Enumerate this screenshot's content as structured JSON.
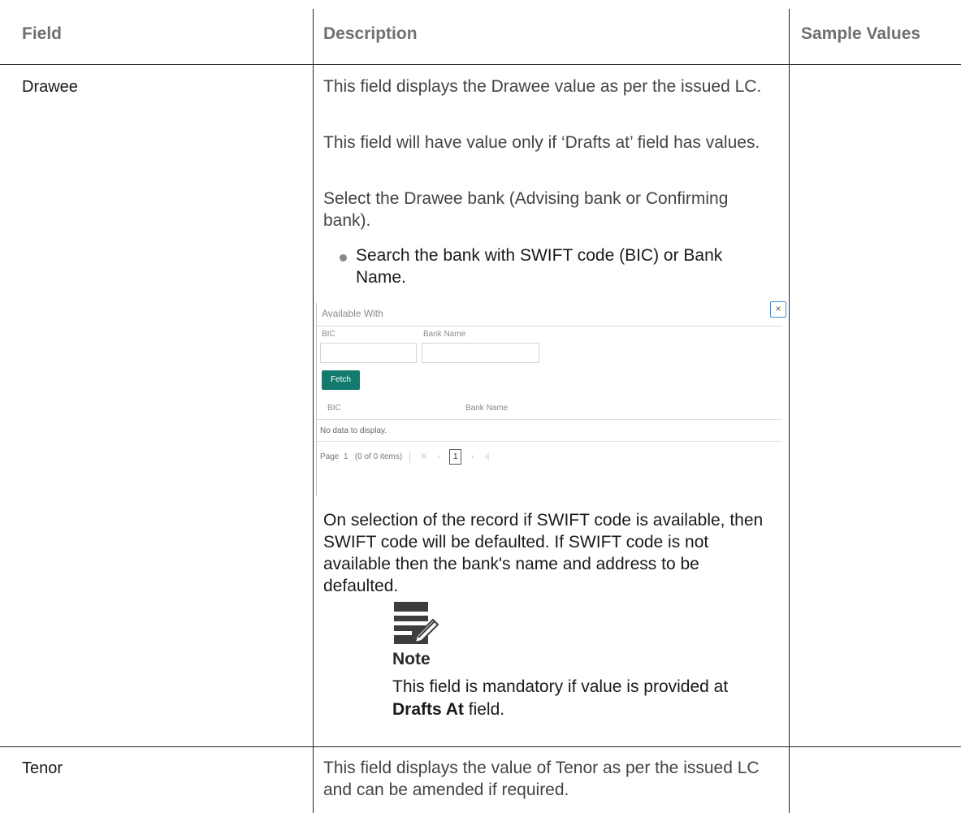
{
  "headers": {
    "field": "Field",
    "description": "Description",
    "sample_values": "Sample Values"
  },
  "rows": [
    {
      "field": "Drawee",
      "paragraphs": [
        "This field displays the Drawee value as per the issued LC.",
        "This field will have value only if ‘Drafts at’ field has values.",
        "Select the Drawee bank (Advising bank or Confirming bank)."
      ],
      "bullet": "Search the bank with SWIFT code (BIC) or Bank Name.",
      "after_image": "On selection of the record if SWIFT code is available, then SWIFT code will be defaulted. If SWIFT code is not available then the bank's name and address to be defaulted.",
      "note": {
        "label": "Note",
        "text_before": "This field is mandatory if value is provided at ",
        "bold": "Drafts At",
        "text_after": " field."
      }
    },
    {
      "field": "Tenor",
      "paragraphs": [
        "This field displays the value of Tenor as per the issued LC and can be amended if required."
      ]
    }
  ],
  "dialog": {
    "title": "Available With",
    "close_icon": "close-icon",
    "bic_label": "BIC",
    "bank_name_label": "Bank Name",
    "bic_value": "",
    "bank_name_value": "",
    "fetch_label": "Fetch",
    "columns": [
      "BIC",
      "Bank Name"
    ],
    "empty_message": "No data to display.",
    "pager": {
      "page_label": "Page",
      "page_number": "1",
      "items_label": "(0 of 0 items)",
      "first": "K",
      "prev": "‹",
      "current": "1",
      "next": "›",
      "last": "›|"
    }
  },
  "note_icon": "note-edit-icon"
}
